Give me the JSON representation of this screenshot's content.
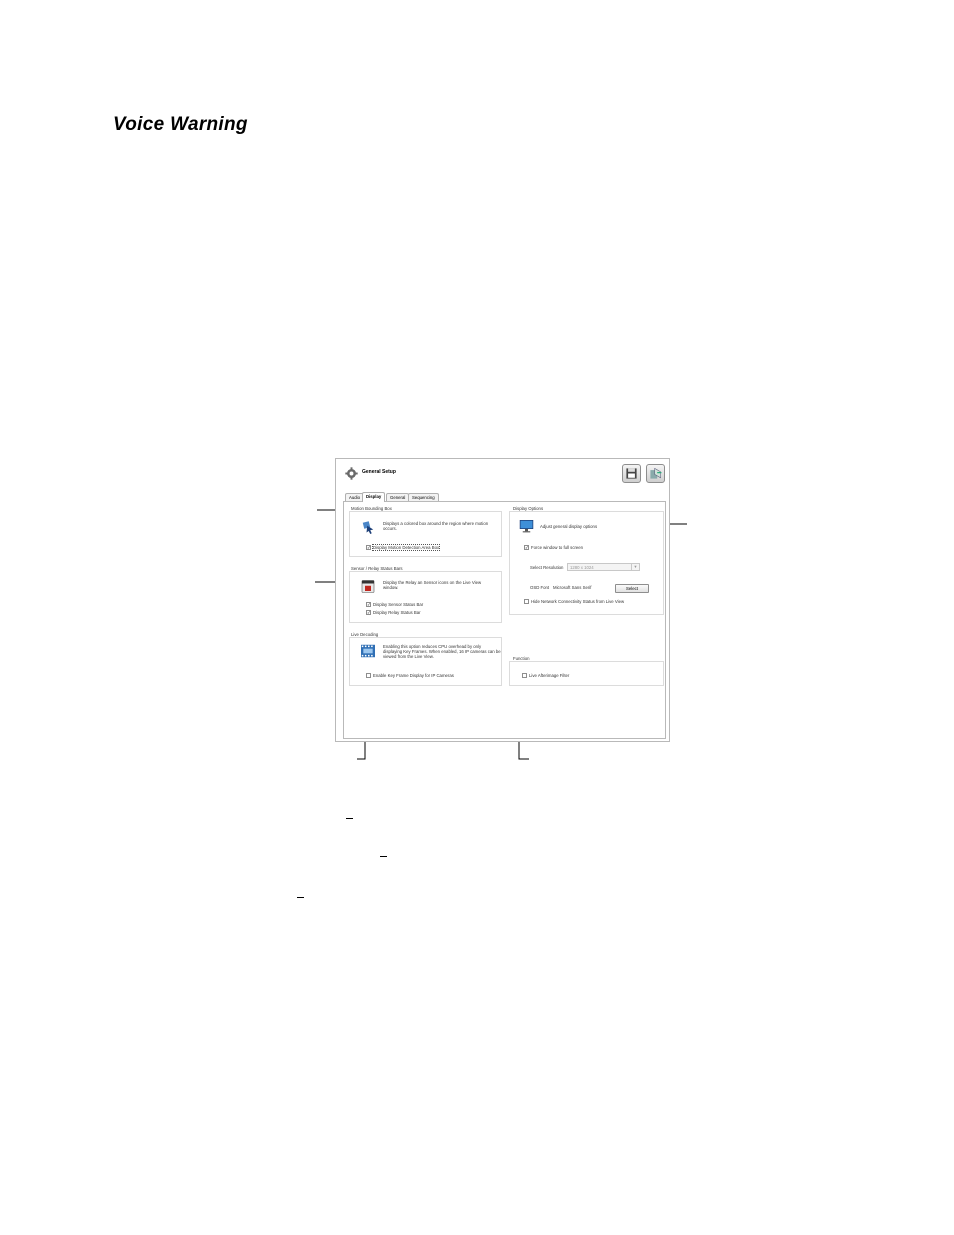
{
  "doc": {
    "heading": "Voice Warning"
  },
  "window": {
    "title": "General Setup",
    "icons": {
      "header": "gear-icon",
      "save": "floppy-disk-icon",
      "exit": "exit-icon"
    },
    "tabs": [
      {
        "label": "Audio",
        "active": false
      },
      {
        "label": "Display",
        "active": true
      },
      {
        "label": "General",
        "active": false
      },
      {
        "label": "Sequencing",
        "active": false
      }
    ],
    "motion_box": {
      "title": "Motion Bounding Box",
      "description": "Displays a colored box around the region where motion occurs.",
      "checkbox": {
        "label": "Display Motion Detection Area Box",
        "checked": true
      }
    },
    "sensor_relay": {
      "title": "Sensor / Relay Status Bars",
      "description": "Display the Relay an Sensor icons on the Live View window.",
      "checkboxes": [
        {
          "label": "Display Sensor Status Bar",
          "checked": true
        },
        {
          "label": "Display Relay Status Bar",
          "checked": true
        }
      ]
    },
    "live_decoding": {
      "title": "Live Decoding",
      "description": "Enabling this option reduces CPU overhead by only displaying Key Frames. When enabled, 16 IP cameras can be viewed from the Live View.",
      "checkbox": {
        "label": "Enable Key Frame Display for IP Cameras",
        "checked": false
      }
    },
    "display_options": {
      "title": "Display Options",
      "description": "Adjust general display options",
      "force_fullscreen": {
        "label": "Force window to full screen",
        "checked": true
      },
      "resolution_label": "Select Resolution",
      "resolution_value": "1280 x 1024",
      "osd_font_label": "OSD Font",
      "osd_font_value": "Microsoft Sans Serif",
      "select_button": "Select",
      "hide_network": {
        "label": "Hide Network Connectivity Status from Live View",
        "checked": false
      }
    },
    "function": {
      "title": "Function",
      "checkbox": {
        "label": "Live Afterimage Filter",
        "checked": false
      }
    }
  },
  "colors": {
    "accent_blue": "#2f6fb5",
    "relay_red": "#c0271f",
    "border_gray": "#b9b9b9"
  }
}
